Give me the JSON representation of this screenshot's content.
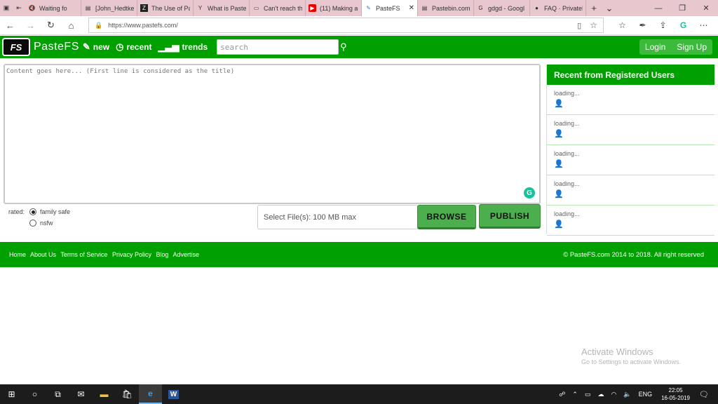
{
  "browser": {
    "tabs": [
      {
        "label": "Waiting fo",
        "icon": "mute-icon"
      },
      {
        "label": "[John_Hedtke,",
        "icon": "doc-icon"
      },
      {
        "label": "The Use of Pa",
        "icon": "z-icon"
      },
      {
        "label": "What is Pastel",
        "icon": "y-icon"
      },
      {
        "label": "Can't reach th",
        "icon": "page-icon"
      },
      {
        "label": "(11) Making a",
        "icon": "youtube-icon"
      },
      {
        "label": "PasteFS",
        "icon": "pastefs-icon",
        "active": true
      },
      {
        "label": "Pastebin.com",
        "icon": "pastebin-icon"
      },
      {
        "label": "gdgd - Googl",
        "icon": "google-icon"
      },
      {
        "label": "FAQ · PrivateB",
        "icon": "github-icon"
      }
    ],
    "url": "https://www.pastefs.com/"
  },
  "header": {
    "logo_text": "FS",
    "brand": "PasteFS",
    "nav": {
      "new": "new",
      "recent": "recent",
      "trends": "trends"
    },
    "search_placeholder": "search",
    "login": "Login",
    "signup": "Sign Up"
  },
  "editor": {
    "placeholder": "Content goes here... (First line is considered as the title)"
  },
  "rating": {
    "label": "rated:",
    "options": [
      "family safe",
      "nsfw"
    ],
    "selected": "family safe"
  },
  "upload": {
    "file_label": "Select File(s): 100 MB max",
    "browse": "BROWSE",
    "publish": "PUBLISH"
  },
  "sidebar": {
    "title": "Recent from Registered Users",
    "items": [
      "loading...",
      "loading...",
      "loading...",
      "loading...",
      "loading..."
    ]
  },
  "footer": {
    "links": [
      "Home",
      "About Us",
      "Terms of Service",
      "Privacy Policy",
      "Blog",
      "Advertise"
    ],
    "copyright": "© PasteFS.com 2014 to 2018. All right reserved"
  },
  "watermark": {
    "title": "Activate Windows",
    "subtitle": "Go to Settings to activate Windows."
  },
  "taskbar": {
    "language": "ENG",
    "time": "22:05",
    "date": "16-05-2019"
  },
  "colors": {
    "brand_green": "#00a000",
    "button_green": "#4cae4c"
  }
}
